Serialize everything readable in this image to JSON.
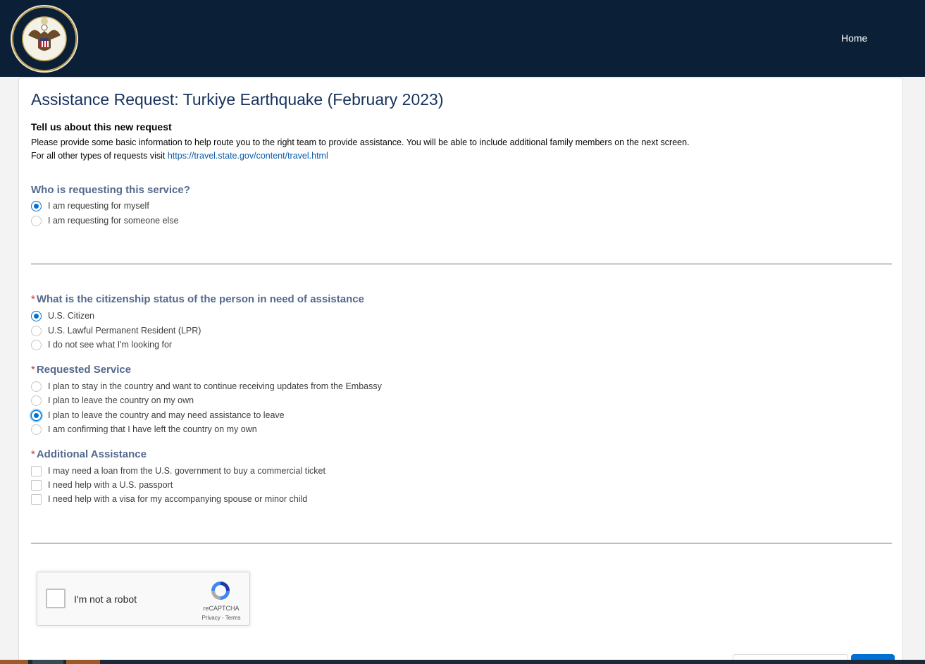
{
  "header": {
    "seal_text": "DEPARTMENT OF STATE · UNITED STATES OF AMERICA",
    "nav_home": "Home"
  },
  "form": {
    "title": "Assistance Request: Turkiye Earthquake (February 2023)",
    "subtitle": "Tell us about this new request",
    "intro": "Please provide some basic information to help route you to the right team to provide assistance. You will be able to include additional family members on the next screen.",
    "other_prefix": "For all other types of requests visit ",
    "other_link": "https://travel.state.gov/content/travel.html",
    "requester": {
      "label": "Who is requesting this service?",
      "options": [
        "I am requesting for myself",
        "I am requesting for someone else"
      ],
      "selected": "I am requesting for myself"
    },
    "citizenship": {
      "required_mark": "*",
      "label": "What is the citizenship status of the person in need of assistance",
      "options": [
        "U.S. Citizen",
        "U.S. Lawful Permanent Resident (LPR)",
        "I do not see what I'm looking for"
      ],
      "selected": "U.S. Citizen"
    },
    "service": {
      "required_mark": "*",
      "label": "Requested Service",
      "options": [
        "I plan to stay in the country and want to continue receiving updates from the Embassy",
        "I plan to leave the country on my own",
        "I plan to leave the country and may need assistance to leave",
        "I am confirming that I have left the country on my own"
      ],
      "selected": "I plan to leave the country and may need assistance to leave"
    },
    "assistance": {
      "required_mark": "*",
      "label": "Additional Assistance",
      "options": [
        "I may need a loan from the U.S. government to buy a commercial ticket",
        "I need help with a U.S. passport",
        "I need help with a visa for my accompanying spouse or minor child"
      ],
      "checked": []
    },
    "captcha": {
      "label": "I'm not a robot",
      "brand": "reCAPTCHA",
      "terms": "Privacy - Terms"
    }
  },
  "colors": {
    "header_bg": "#0b2037",
    "accent": "#0070d2",
    "required": "#c23934",
    "link": "#0b5cab"
  }
}
